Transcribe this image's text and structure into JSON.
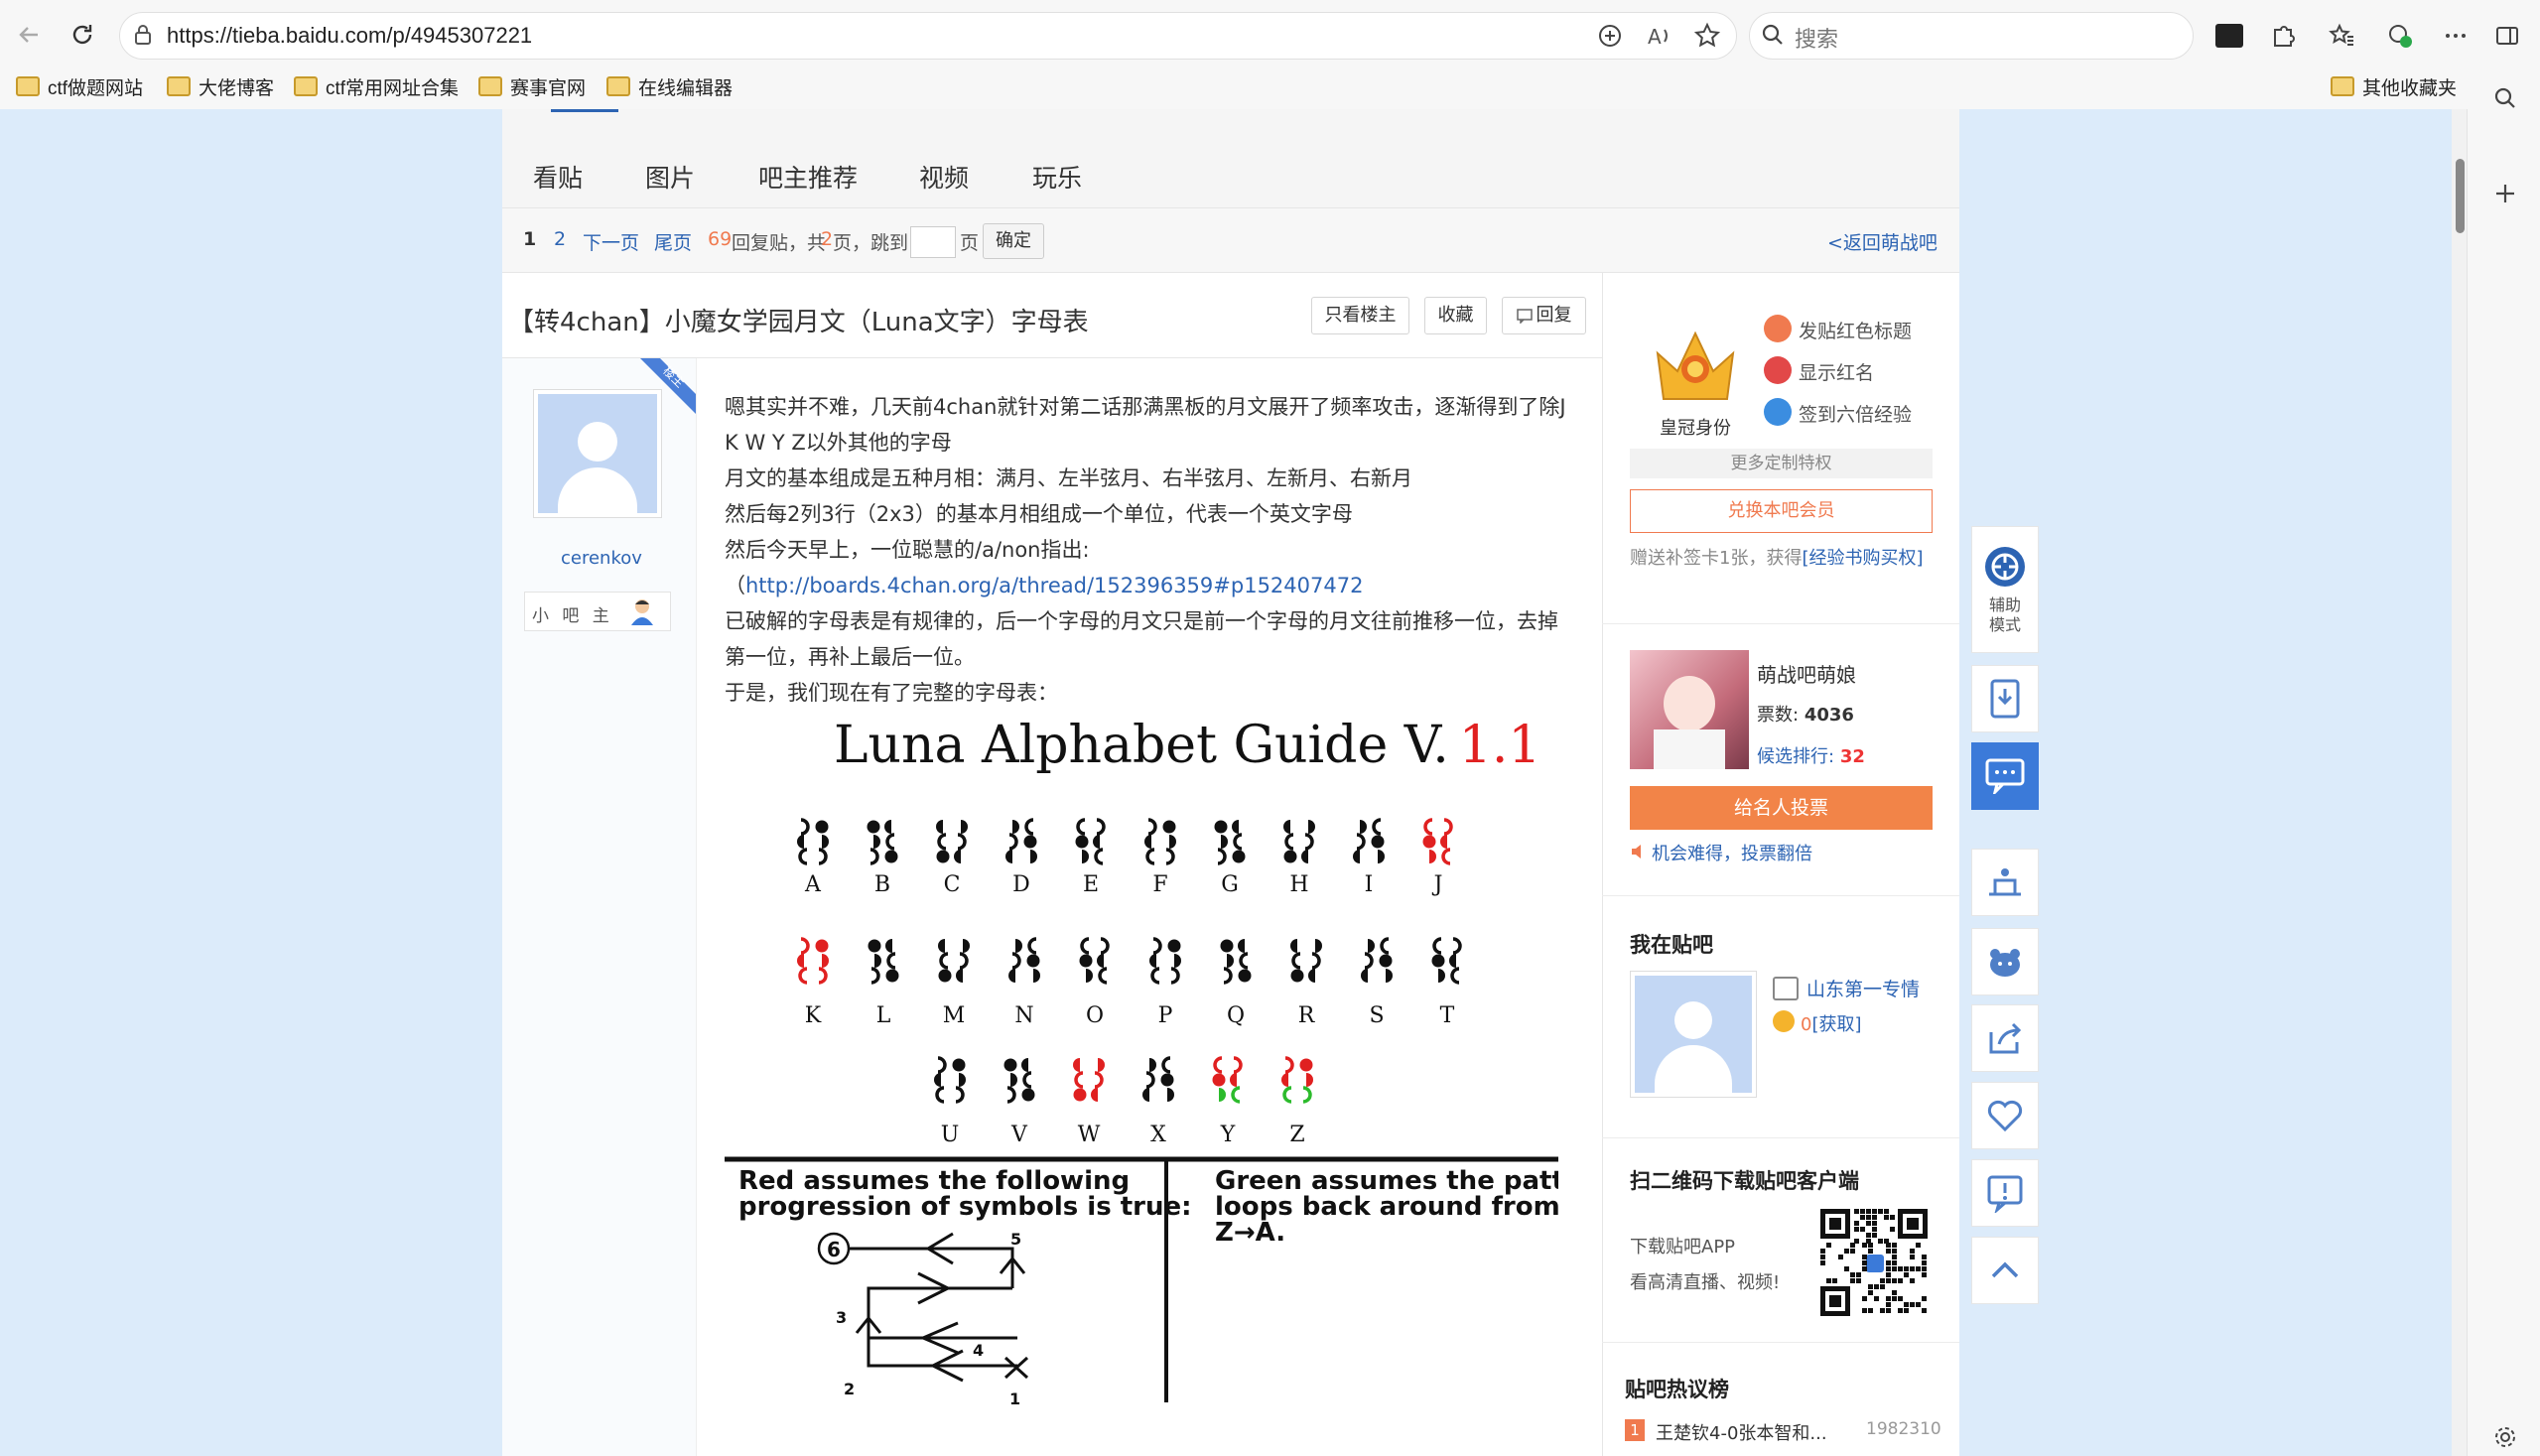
{
  "browser": {
    "url": "https://tieba.baidu.com/p/4945307221",
    "search_placeholder": "搜索",
    "bookmarks": [
      "ctf做题网站",
      "大佬博客",
      "ctf常用网址合集",
      "赛事官网",
      "在线编辑器"
    ],
    "other_bookmarks": "其他收藏夹"
  },
  "nav": {
    "tabs": [
      "看贴",
      "图片",
      "吧主推荐",
      "视频",
      "玩乐"
    ]
  },
  "pager": {
    "current": "1",
    "next_page_number": "2",
    "next": "下一页",
    "last": "尾页",
    "reply_count": "69",
    "reply_label": "回复贴，共",
    "total_pages": "2",
    "pages_label": "页，跳到",
    "page_unit": "页",
    "ok": "确定",
    "back_link": "<返回萌战吧"
  },
  "post": {
    "title": "【转4chan】小魔女学园月文（Luna文字）字母表",
    "only_op": "只看楼主",
    "favorite": "收藏",
    "reply": "回复",
    "corner_tag": "楼主",
    "author": "cerenkov",
    "role": "小 吧 主",
    "paragraphs": [
      "嗯其实并不难，几天前4chan就针对第二话那满黑板的月文展开了频率攻击，逐渐得到了除J",
      "K W Y Z以外其他的字母",
      "月文的基本组成是五种月相：满月、左半弦月、右半弦月、左新月、右新月",
      "然后每2列3行（2x3）的基本月相组成一个单位，代表一个英文字母",
      "然后今天早上，一位聪慧的/a/non指出:",
      "已破解的字母表是有规律的，后一个字母的月文只是前一个字母的月文往前推移一位，去掉",
      "第一位，再补上最后一位。",
      "于是，我们现在有了完整的字母表："
    ],
    "link_prefix": "（",
    "link": "http://boards.4chan.org/a/thread/152396359#p152407472"
  },
  "figure": {
    "title_main": "Luna Alphabet Guide V.",
    "title_version": "1.1",
    "letters_row1": [
      "A",
      "B",
      "C",
      "D",
      "E",
      "F",
      "G",
      "H",
      "I",
      "J"
    ],
    "letters_row2": [
      "K",
      "L",
      "M",
      "N",
      "O",
      "P",
      "Q",
      "R",
      "S",
      "T"
    ],
    "letters_row3": [
      "U",
      "V",
      "W",
      "X",
      "Y",
      "Z"
    ],
    "note_left_line1": "Red assumes the following",
    "note_left_line2": "progression of symbols is true:",
    "note_right_line1": "Green assumes the pattern",
    "note_right_line2": "loops back around from",
    "note_right_line3": "Z→A.",
    "diagram_nums": [
      "6",
      "5",
      "3",
      "4",
      "2",
      "1"
    ],
    "colors": {
      "red": "#e02020",
      "green": "#2cbb2c",
      "black": "#111111"
    }
  },
  "sidebar": {
    "crown_label": "皇冠身份",
    "privileges": [
      "发贴红色标题",
      "显示红名",
      "签到六倍经验"
    ],
    "more": "更多定制特权",
    "redeem": "兑换本吧会员",
    "gift_text": "赠送补签卡1张，获得",
    "gift_link": "[经验书购买权]",
    "mascot_title": "萌战吧萌娘",
    "votes_label": "票数:",
    "votes": "4036",
    "rank_label": "候选排行:",
    "rank": "32",
    "vote_btn": "给名人投票",
    "vote_tip": "机会难得，投票翻倍",
    "my_bar": "我在贴吧",
    "my_bar_name": "山东第一专情",
    "my_bar_points": "0",
    "my_bar_get": "[获取]",
    "qr_title": "扫二维码下载贴吧客户端",
    "qr_line1": "下载贴吧APP",
    "qr_line2": "看高清直播、视频!",
    "hot_title": "贴吧热议榜",
    "hot_rank": "1",
    "hot_item": "王楚钦4-0张本智和...",
    "hot_count": "1982310"
  },
  "tools": {
    "assist_mode": "辅助\n模式"
  }
}
